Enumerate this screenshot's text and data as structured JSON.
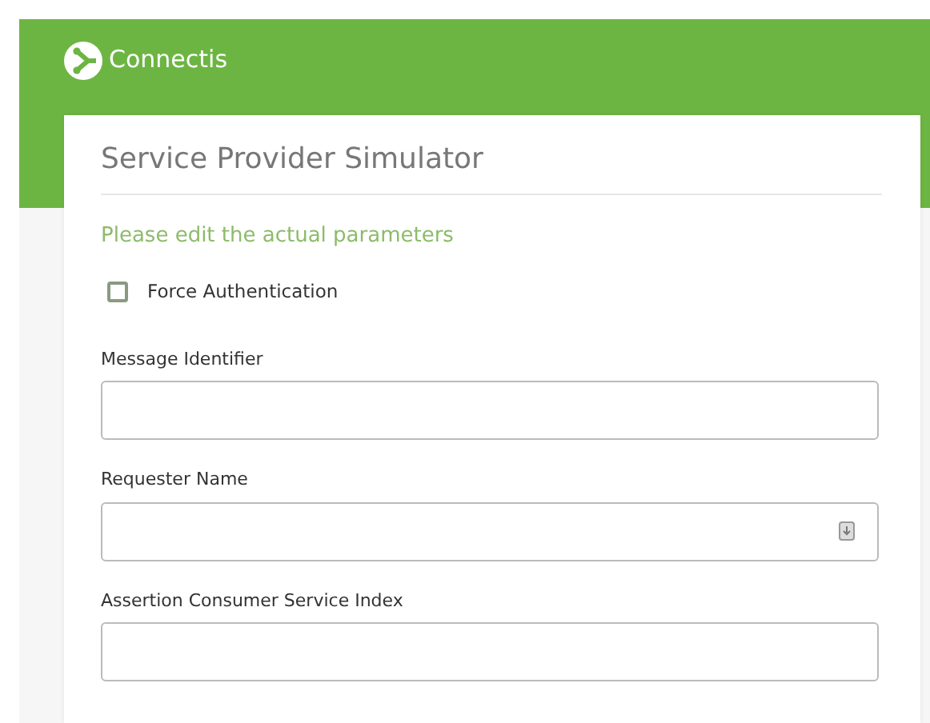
{
  "brand": {
    "name": "Connectis"
  },
  "card": {
    "title": "Service Provider Simulator",
    "subtitle": "Please edit the actual parameters"
  },
  "checkbox": {
    "label": "Force Authentication",
    "checked": false
  },
  "fields": [
    {
      "label": "Message Identifier",
      "kind": "text"
    },
    {
      "label": "Requester Name",
      "kind": "autofill"
    },
    {
      "label": "Assertion Consumer Service Index",
      "kind": "text"
    }
  ]
}
